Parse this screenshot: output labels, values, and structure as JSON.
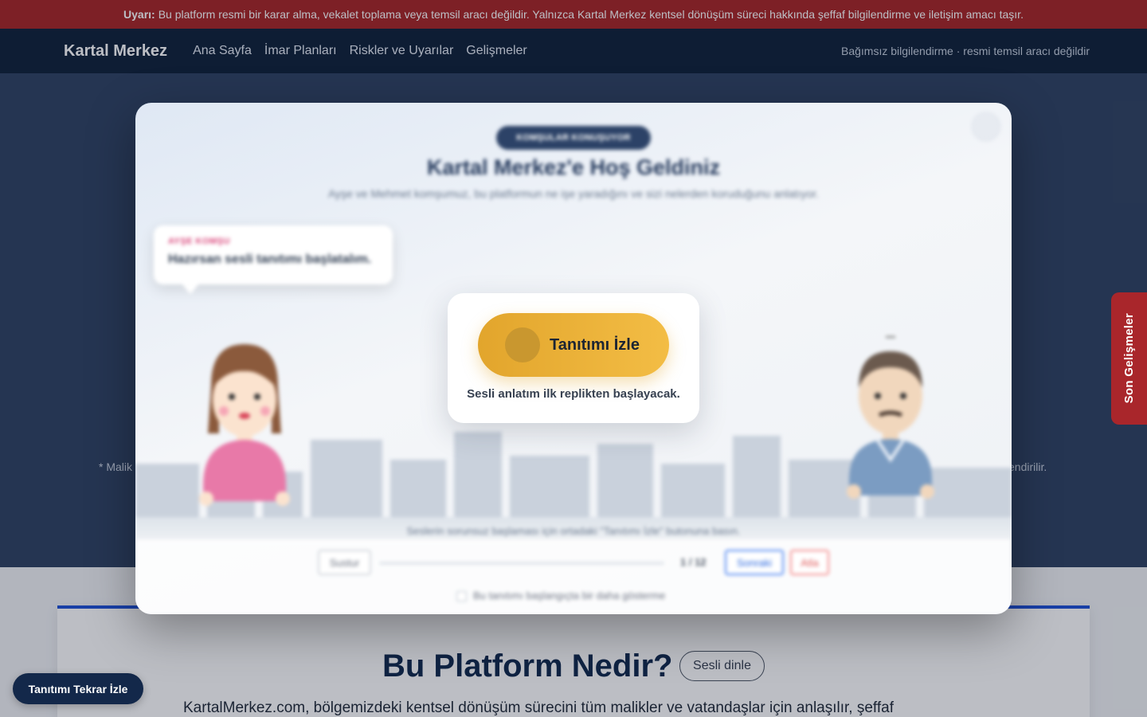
{
  "warning": {
    "label": "Uyarı:",
    "text": "Bu platform resmi bir karar alma, vekalet toplama veya temsil aracı değildir. Yalnızca Kartal Merkez kentsel dönüşüm süreci hakkında şeffaf bilgilendirme ve iletişim amacı taşır."
  },
  "nav": {
    "brand": "Kartal Merkez",
    "links": [
      "Ana Sayfa",
      "İmar Planları",
      "Riskler ve Uyarılar",
      "Gelişmeler"
    ],
    "right_note": "Bağımsız bilgilendirme · resmi temsil aracı değildir"
  },
  "hero": {
    "note_left": "* Malik",
    "note_right": "endirilir."
  },
  "side_tab": {
    "label": "Son Gelişmeler"
  },
  "about": {
    "title": "Bu Platform Nedir?",
    "listen_label": "Sesli dinle",
    "text": "KartalMerkez.com, bölgemizdeki kentsel dönüşüm sürecini tüm malikler ve vatandaşlar için anlaşılır, şeffaf"
  },
  "replay_button": "Tanıtımı Tekrar İzle",
  "modal": {
    "badge": "KOMŞULAR KONUŞUYOR",
    "title": "Kartal Merkez'e Hoş Geldiniz",
    "subtitle": "Ayşe ve Mehmet komşumuz, bu platformun ne işe yaradığını ve sizi nelerden koruduğunu anlatıyor.",
    "bubble": {
      "speaker": "AYŞE KOMŞU",
      "text": "Hazırsan sesli tanıtımı başlatalım."
    },
    "start": {
      "button": "Tanıtımı İzle",
      "note": "Sesli anlatım ilk replikten başlayacak."
    },
    "hint": "Seslerin sorunsuz başlaması için ortadaki \"Tanıtımı İzle\" butonuna basın.",
    "controls": {
      "mute": "Sustur",
      "step": "1 / 12",
      "next": "Sonraki",
      "skip": "Atla",
      "dont_show": "Bu tanıtımı başlangıçta bir daha gösterme"
    }
  },
  "colors": {
    "warning_bg": "#a82424",
    "nav_bg": "#0e2038",
    "hero_bg": "#2f4262",
    "accent": "#f3bd45",
    "badge_bg": "#2c4267"
  }
}
